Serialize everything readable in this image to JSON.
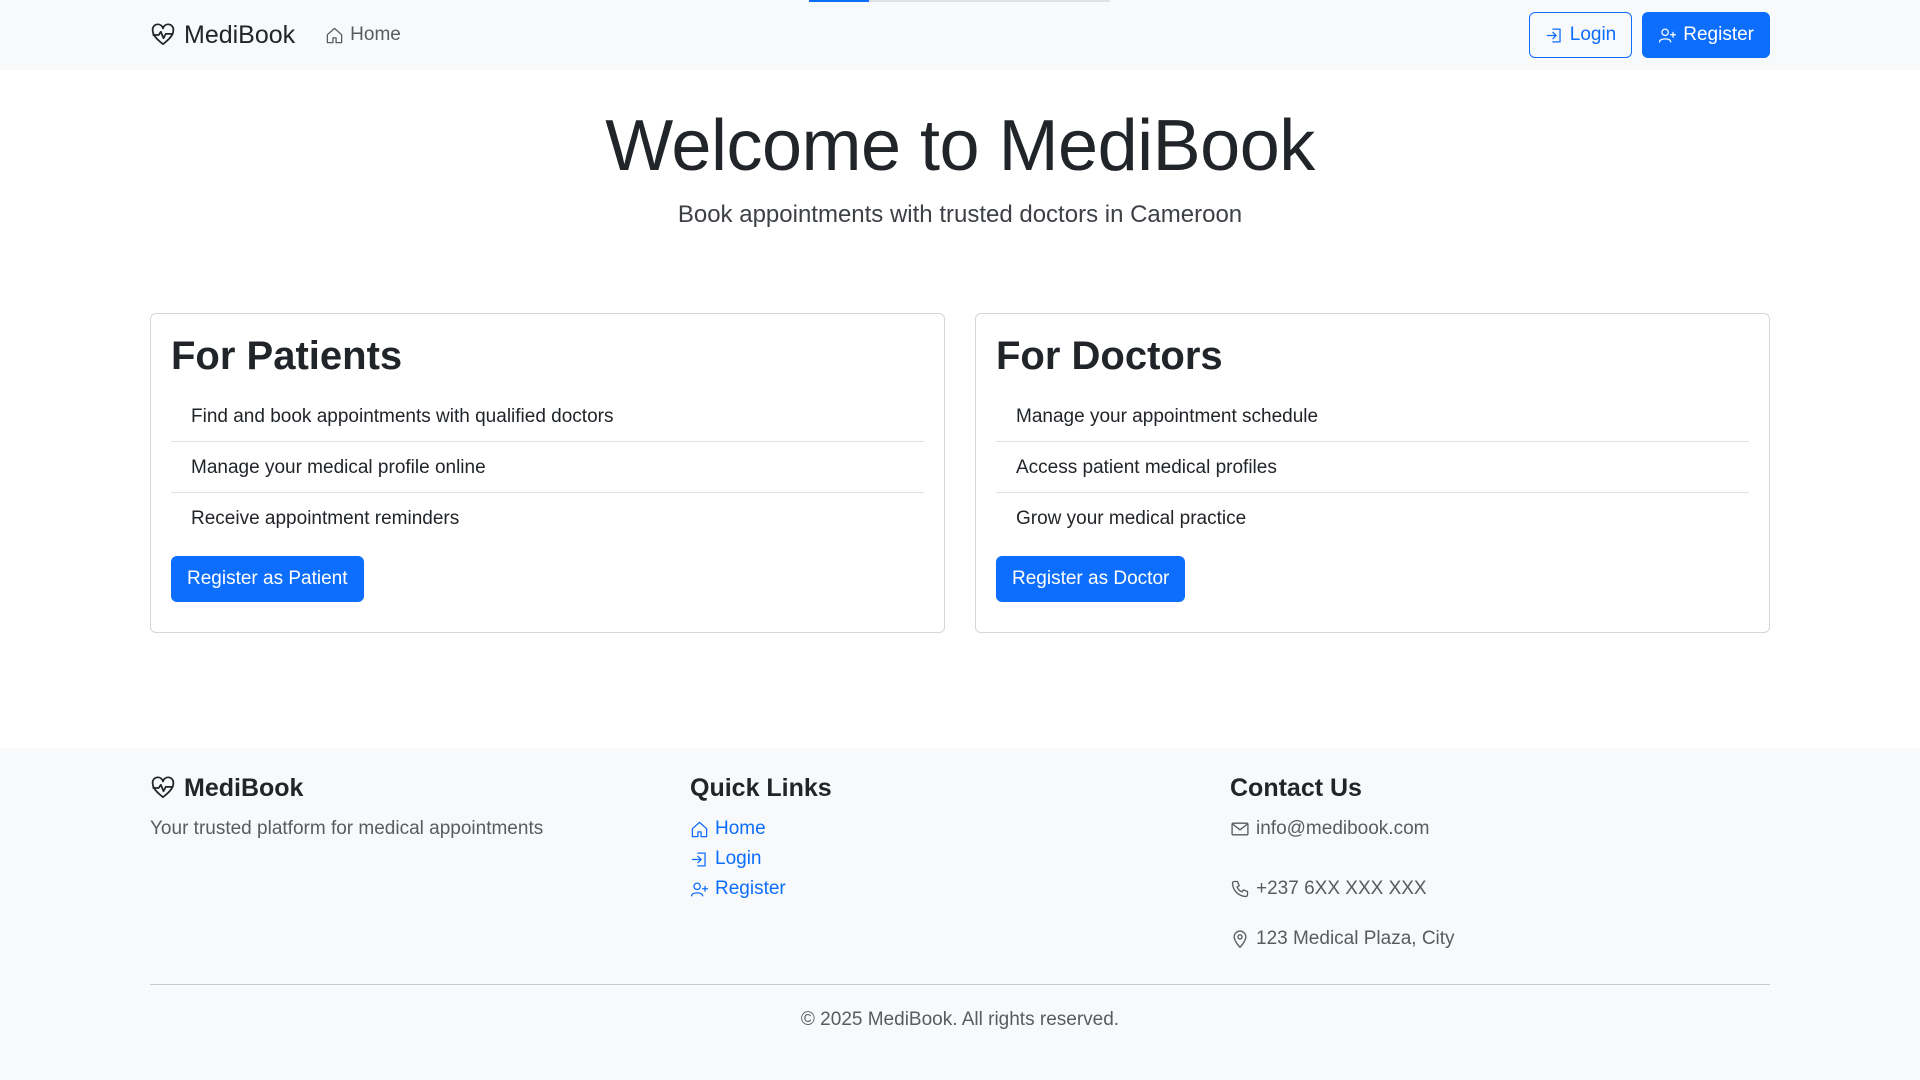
{
  "colors": {
    "primary": "#0d6efd",
    "navbar_bg": "#f8f9fa",
    "footer_bg": "#f8f9fa",
    "text": "#212529",
    "muted": "#595c5f"
  },
  "navbar": {
    "brand": "MediBook",
    "brand_icon": "heart-pulse-icon",
    "home_label": "Home",
    "login_label": "Login",
    "register_label": "Register"
  },
  "hero": {
    "title": "Welcome to MediBook",
    "subtitle": "Book appointments with trusted doctors in Cameroon"
  },
  "cards": {
    "patients": {
      "title": "For Patients",
      "items": [
        "Find and book appointments with qualified doctors",
        "Manage your medical profile online",
        "Receive appointment reminders"
      ],
      "button_label": "Register as Patient"
    },
    "doctors": {
      "title": "For Doctors",
      "items": [
        "Manage your appointment schedule",
        "Access patient medical profiles",
        "Grow your medical practice"
      ],
      "button_label": "Register as Doctor"
    }
  },
  "footer": {
    "brand": "MediBook",
    "tagline": "Your trusted platform for medical appointments",
    "quick_links_title": "Quick Links",
    "quick_links": [
      "Home",
      "Login",
      "Register"
    ],
    "contact_title": "Contact Us",
    "email": "info@medibook.com",
    "phone": "+237 6XX XXX XXX",
    "address": "123 Medical Plaza, City",
    "copyright": "© 2025 MediBook. All rights reserved."
  }
}
